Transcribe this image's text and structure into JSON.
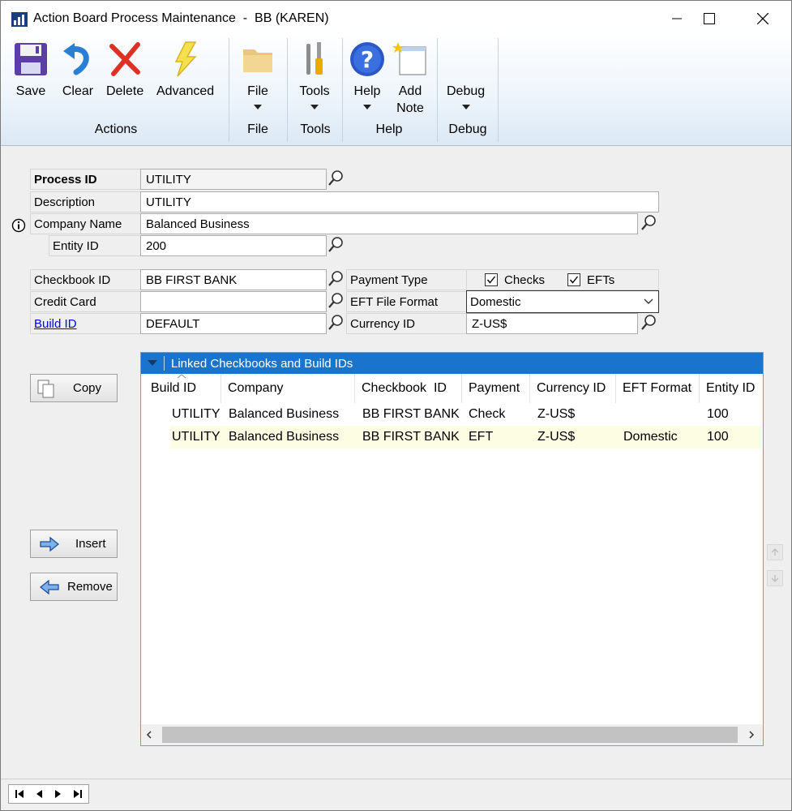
{
  "window": {
    "title": "Action Board Process Maintenance  -  BB (KAREN)"
  },
  "ribbon": {
    "buttons": {
      "save": "Save",
      "clear": "Clear",
      "delete": "Delete",
      "advanced": "Advanced",
      "file": "File",
      "tools": "Tools",
      "help": "Help",
      "add_note_1": "Add",
      "add_note_2": "Note",
      "debug": "Debug"
    },
    "groups": {
      "actions": "Actions",
      "file": "File",
      "tools": "Tools",
      "help": "Help",
      "debug": "Debug"
    }
  },
  "form": {
    "process_id_label": "Process ID",
    "process_id_value": "UTILITY",
    "description_label": "Description",
    "description_value": "UTILITY",
    "company_name_label": "Company Name",
    "company_name_value": "Balanced Business",
    "entity_id_label": "Entity ID",
    "entity_id_value": "200",
    "checkbook_id_label": "Checkbook ID",
    "checkbook_id_value": "BB FIRST BANK",
    "credit_card_label": "Credit Card",
    "credit_card_value": "",
    "build_id_label": "Build ID",
    "build_id_value": "DEFAULT",
    "payment_type_label": "Payment Type",
    "checks_label": "Checks",
    "checks_checked": true,
    "efts_label": "EFTs",
    "efts_checked": true,
    "eft_file_format_label": "EFT File Format",
    "eft_file_format_value": "Domestic",
    "currency_id_label": "Currency ID",
    "currency_id_value": "Z-US$"
  },
  "side_buttons": {
    "copy": "Copy",
    "insert": "Insert",
    "remove": "Remove"
  },
  "grid": {
    "title": "Linked Checkbooks and Build IDs",
    "columns": [
      "Build ID",
      "Company",
      "Checkbook  ID",
      "Payment",
      "Currency ID",
      "EFT Format",
      "Entity ID"
    ],
    "rows": [
      [
        "UTILITY",
        "Balanced Business",
        "BB FIRST BANK",
        "Check",
        "Z-US$",
        "",
        "100"
      ],
      [
        "UTILITY",
        "Balanced Business",
        "BB FIRST BANK",
        "EFT",
        "Z-US$",
        "Domestic",
        "100"
      ]
    ]
  },
  "colors": {
    "grid_header": "#1874cd",
    "selected_row": "#fdfde4",
    "link": "#0000ee"
  }
}
